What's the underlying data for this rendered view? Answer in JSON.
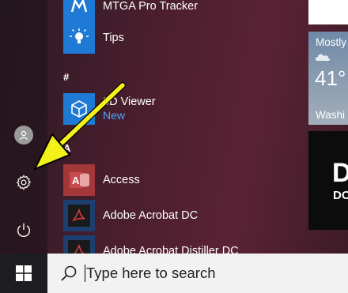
{
  "apps": [
    {
      "name": "MTGA Pro Tracker"
    },
    {
      "name": "Tips"
    },
    {
      "name": "3D Viewer",
      "sub": "New"
    },
    {
      "name": "Access"
    },
    {
      "name": "Adobe Acrobat DC"
    },
    {
      "name": "Adobe Acrobat Distiller DC"
    }
  ],
  "sections": {
    "hash": "#",
    "a": "A"
  },
  "tiles": {
    "weather": {
      "top": "Mostly",
      "temp": "41°",
      "city": "Washi"
    },
    "black": {
      "text1": "D",
      "text2": "DO"
    }
  },
  "taskbar": {
    "search_placeholder": "Type here to search"
  },
  "colors": {
    "annotation_arrow": "#f4f11a",
    "tile_blue": "#1f7ad6",
    "access_red": "#a4373a"
  }
}
